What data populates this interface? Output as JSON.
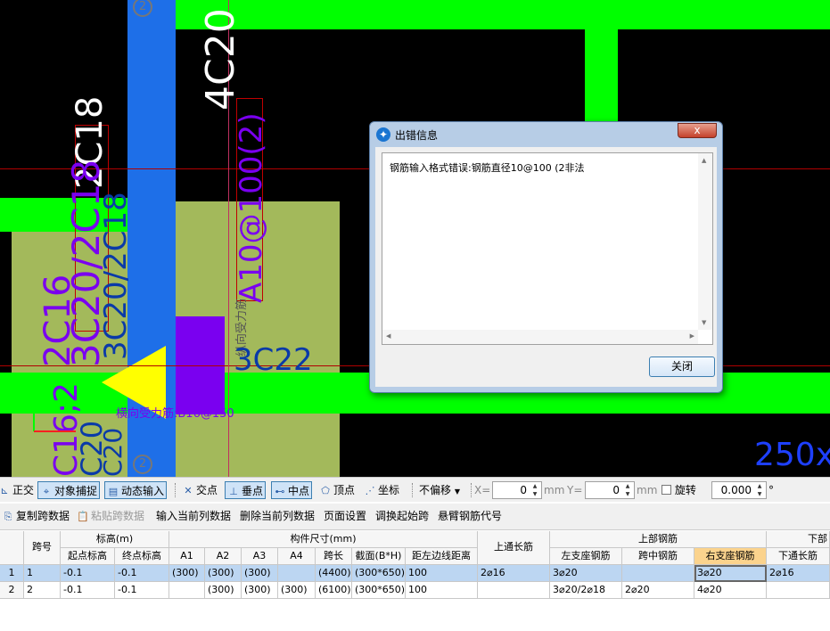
{
  "canvas": {
    "axis_labels": [
      "2",
      "2"
    ],
    "texts": {
      "top_rebar": "4C20",
      "col_a": "2C18",
      "col_b": "3C20/2C18",
      "col_c": "3C20/2C18",
      "col_d": "2C16",
      "col_e": "C16;2",
      "col_f": "C20",
      "col_g": "C20",
      "stirrup": "A10@100(2)",
      "tie": "纵向受力筋",
      "bottom_bar": "3C22",
      "horiz_note": "横向受力筋:B16@150",
      "dim": "250x"
    },
    "colors": {
      "beam": "#00ff00",
      "column": "#1e6fe8",
      "slab": "#a3b95b",
      "wall": "#7a00f0",
      "grid_line": "#b00000",
      "text_blue": "#0a3aa8"
    }
  },
  "dialog": {
    "title": "出错信息",
    "message": "钢筋输入格式错误:钢筋直径10@100 (2非法",
    "close_label": "关闭",
    "titlebar_close": "x"
  },
  "toolbar1": {
    "items": [
      "正交",
      "对象捕捉",
      "动态输入",
      "交点",
      "垂点",
      "中点",
      "顶点",
      "坐标"
    ],
    "offset_label": "不偏移",
    "x_label": "X=",
    "x_value": "0",
    "y_label": "Y=",
    "y_value": "0",
    "unit": "mm",
    "rotate_label": "旋转",
    "rotate_value": "0.000",
    "degree": "°"
  },
  "toolbar2": {
    "items": [
      "复制跨数据",
      "粘贴跨数据",
      "输入当前列数据",
      "删除当前列数据",
      "页面设置",
      "调换起始跨",
      "悬臂钢筋代号"
    ]
  },
  "grid": {
    "header_top": [
      "跨号",
      "标高(m)",
      "构件尺寸(mm)",
      "上通长筋",
      "上部钢筋",
      "下部"
    ],
    "header_sub": [
      "起点标高",
      "终点标高",
      "A1",
      "A2",
      "A3",
      "A4",
      "跨长",
      "截面(B*H)",
      "距左边线距离",
      "左支座钢筋",
      "跨中钢筋",
      "右支座钢筋",
      "下通长筋"
    ],
    "rows": [
      {
        "no": "1",
        "span": "1",
        "start": "-0.1",
        "end": "-0.1",
        "a1": "(300)",
        "a2": "(300)",
        "a3": "(300)",
        "a4": "",
        "len": "(4400)",
        "sec": "(300*650)",
        "dist": "100",
        "top_through": "2⌀16",
        "left": "3⌀20",
        "mid": "",
        "right": "3⌀20",
        "bot_through": "2⌀16"
      },
      {
        "no": "2",
        "span": "2",
        "start": "-0.1",
        "end": "-0.1",
        "a1": "",
        "a2": "(300)",
        "a3": "(300)",
        "a4": "(300)",
        "len": "(6100)",
        "sec": "(300*650)",
        "dist": "100",
        "top_through": "",
        "left": "3⌀20/2⌀18",
        "mid": "2⌀20",
        "right": "4⌀20",
        "bot_through": ""
      }
    ]
  }
}
